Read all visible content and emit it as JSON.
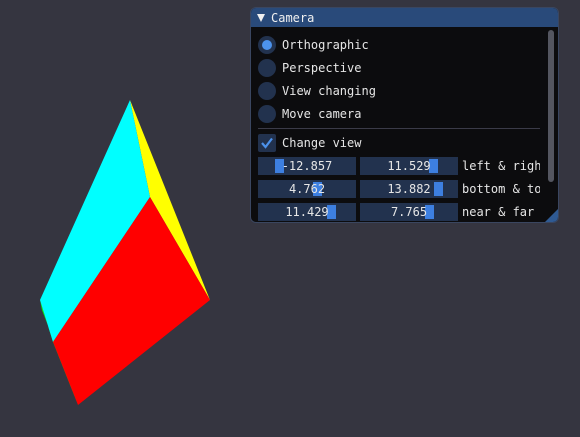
{
  "colors": {
    "background": "#353540",
    "face_front": "#ff0000",
    "face_top": "#00ffff",
    "face_right": "#ffff00",
    "face_left": "#00ff00",
    "window_title": "#294a7a",
    "accent": "#4c92ec"
  },
  "window": {
    "title": "Camera",
    "projection_options": [
      {
        "label": "Orthographic",
        "selected": true
      },
      {
        "label": "Perspective",
        "selected": false
      },
      {
        "label": "View changing",
        "selected": false
      },
      {
        "label": "Move camera",
        "selected": false
      }
    ],
    "change_view": {
      "label": "Change view",
      "checked": true
    },
    "sliders": [
      {
        "label": "left & righ",
        "values": [
          "-12.857",
          "11.529"
        ],
        "fractions": [
          0.19,
          0.77
        ]
      },
      {
        "label": "bottom & to",
        "values": [
          "4.762",
          "13.882"
        ],
        "fractions": [
          0.62,
          0.83
        ]
      },
      {
        "label": "near & far",
        "values": [
          "11.429",
          "7.765"
        ],
        "fractions": [
          0.78,
          0.73
        ]
      }
    ]
  }
}
